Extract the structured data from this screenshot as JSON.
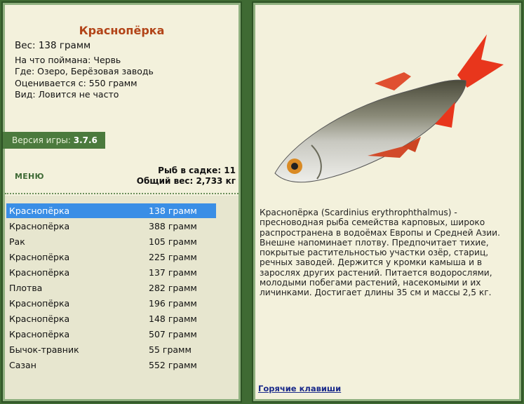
{
  "left": {
    "fish_name": "Краснопёрка",
    "weight_line": "Вес: 138 грамм",
    "info": [
      "На что поймана: Червь",
      "Где: Озеро, Берёзовая заводь",
      "Оценивается с: 550 грамм",
      "Вид: Ловится не часто"
    ],
    "version_label": "Версия игры:",
    "version_value": "3.7.6",
    "menu_label": "МЕНЮ",
    "stats": {
      "count_line": "Рыб в садке: 11",
      "total_line": "Общий вес: 2,733 кг"
    },
    "catches": [
      {
        "name": "Краснопёрка",
        "weight": "138 грамм",
        "selected": true
      },
      {
        "name": "Краснопёрка",
        "weight": "388 грамм"
      },
      {
        "name": "Рак",
        "weight": "105 грамм"
      },
      {
        "name": "Краснопёрка",
        "weight": "225 грамм"
      },
      {
        "name": "Краснопёрка",
        "weight": "137 грамм"
      },
      {
        "name": "Плотва",
        "weight": "282 грамм"
      },
      {
        "name": "Краснопёрка",
        "weight": "196 грамм"
      },
      {
        "name": "Краснопёрка",
        "weight": "148 грамм"
      },
      {
        "name": "Краснопёрка",
        "weight": "507 грамм"
      },
      {
        "name": "Бычок-травник",
        "weight": "55 грамм"
      },
      {
        "name": "Сазан",
        "weight": "552 грамм"
      }
    ]
  },
  "right": {
    "description": "Краснопёрка (Scardinius erythrophthalmus) - пресноводная рыба семейства карповых, широко распространена в водоёмах Европы и Средней Азии. Внешне напоминает плотву. Предпочитает тихие, покрытые растительностью участки озёр, стариц, речных заводей. Держится у кромки камыша и в зарослях других растений. Питается водорослями, молодыми побегами растений, насекомыми и их личинками. Достигает длины 35 см и массы 2,5 кг.",
    "hotkeys_label": "Горячие клавиши"
  },
  "colors": {
    "frame": "#3f6a33",
    "panel_bg": "#f3f1dc",
    "title": "#b24418",
    "selection": "#3a8ee6",
    "version_bg": "#4b7a3d",
    "fin_red": "#e8361c"
  }
}
